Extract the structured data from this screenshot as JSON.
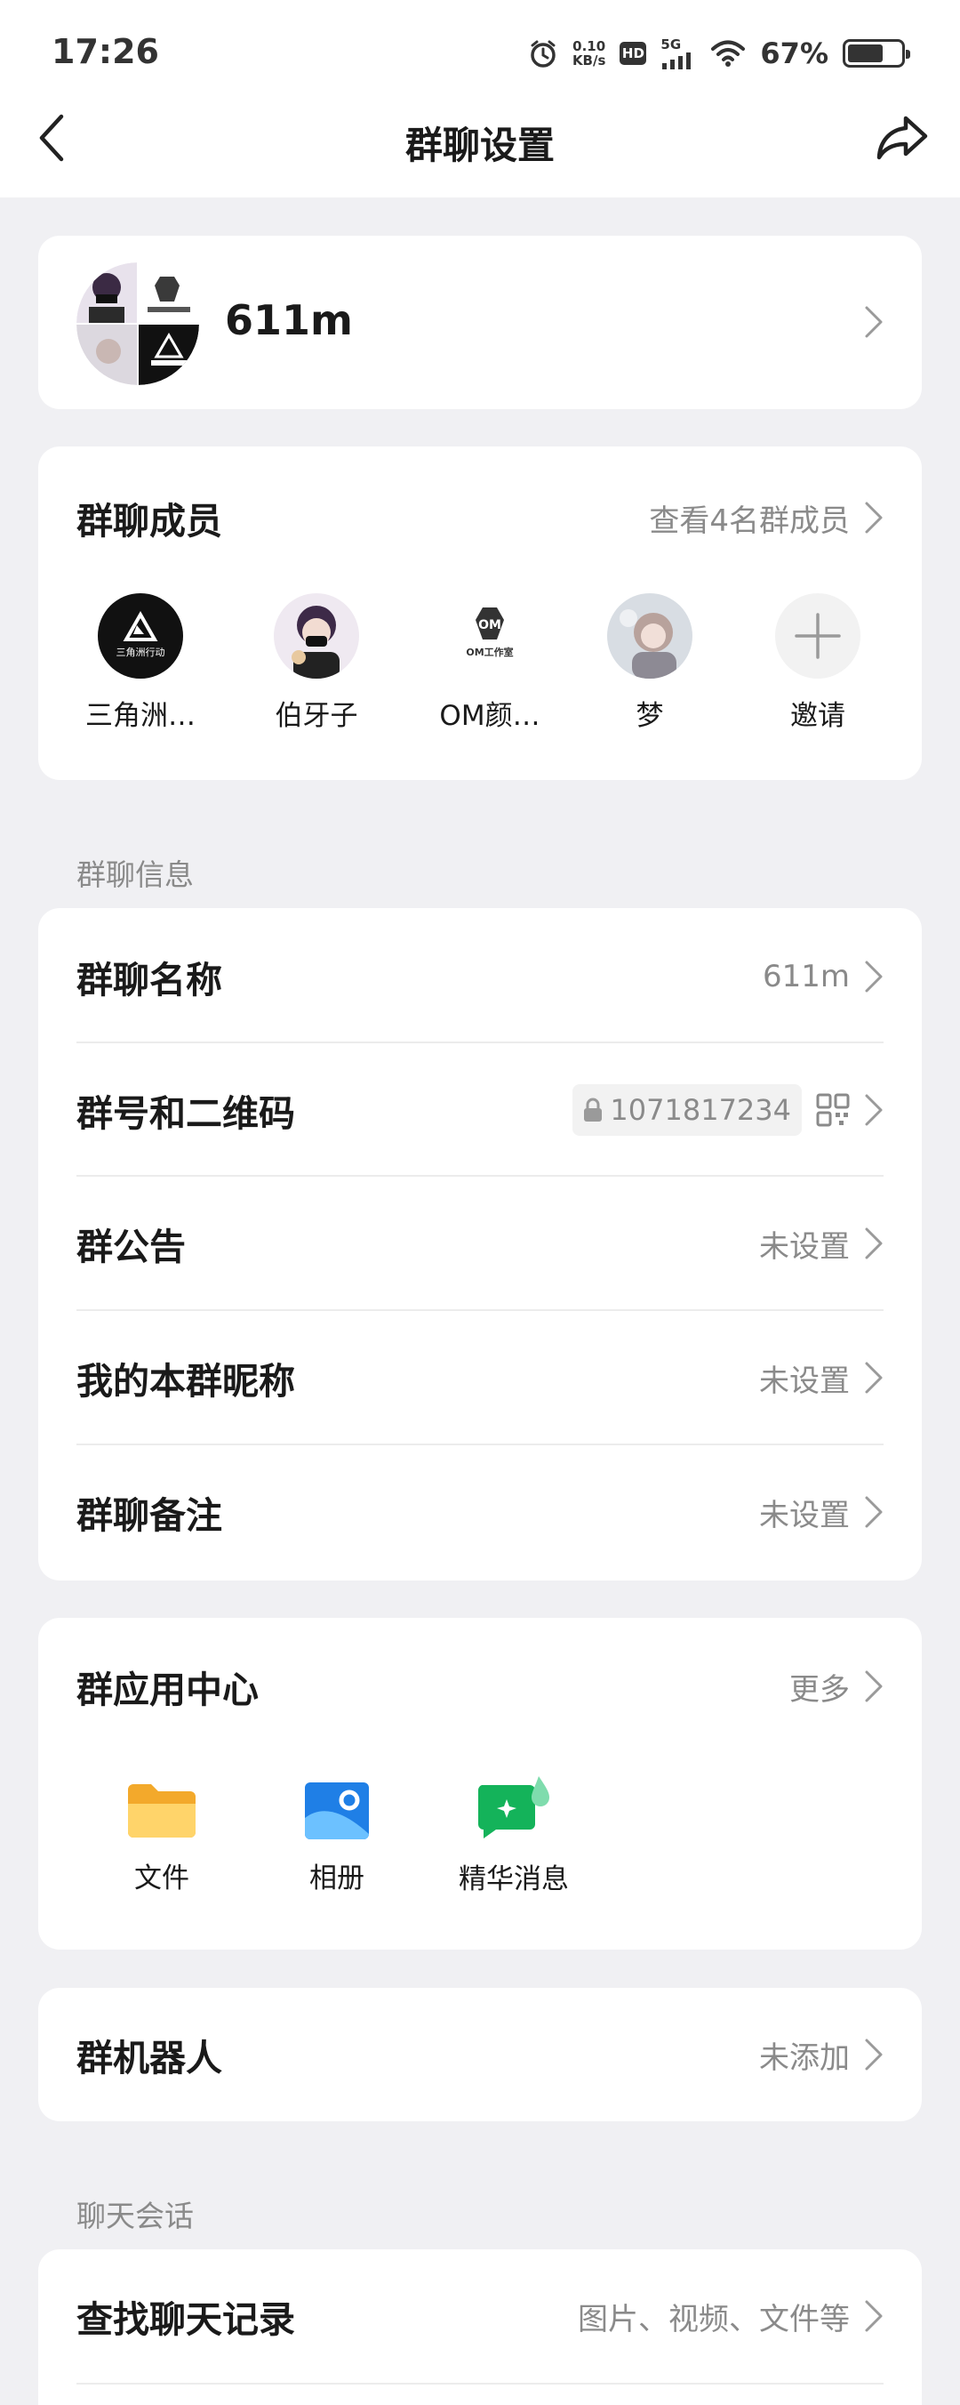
{
  "status_bar": {
    "time": "17:26",
    "speed_value": "0.10",
    "speed_unit": "KB/s",
    "hd": "HD",
    "network": "5G",
    "battery_percent": "67%",
    "battery_level": 0.67
  },
  "nav": {
    "title": "群聊设置",
    "back_icon": "chevron-left-icon",
    "share_icon": "share-icon"
  },
  "group": {
    "name": "611m"
  },
  "members": {
    "title": "群聊成员",
    "view_all": "查看4名群成员",
    "list": [
      {
        "name": "三角洲…",
        "avatar_text": "三角洲行动"
      },
      {
        "name": "伯牙子"
      },
      {
        "name": "OM颜…",
        "avatar_text": "OM工作室"
      },
      {
        "name": "梦"
      },
      {
        "name": "邀请"
      }
    ]
  },
  "info_section": {
    "label": "群聊信息",
    "rows": [
      {
        "label": "群聊名称",
        "value": "611m"
      },
      {
        "label": "群号和二维码",
        "value": "1071817234"
      },
      {
        "label": "群公告",
        "value": "未设置"
      },
      {
        "label": "我的本群昵称",
        "value": "未设置"
      },
      {
        "label": "群聊备注",
        "value": "未设置"
      }
    ]
  },
  "apps": {
    "title": "群应用中心",
    "more": "更多",
    "list": [
      {
        "name": "文件",
        "icon": "folder-icon",
        "color": "#f7b733"
      },
      {
        "name": "相册",
        "icon": "album-icon",
        "color": "#2a8ef0"
      },
      {
        "name": "精华消息",
        "icon": "highlight-message-icon",
        "color": "#16b85c"
      }
    ]
  },
  "robot": {
    "label": "群机器人",
    "value": "未添加"
  },
  "chat_section": {
    "label": "聊天会话",
    "search": {
      "label": "查找聊天记录",
      "value": "图片、视频、文件等"
    }
  },
  "colors": {
    "background": "#f0f0f3",
    "card": "#ffffff",
    "text_secondary": "#8a8a8a"
  }
}
